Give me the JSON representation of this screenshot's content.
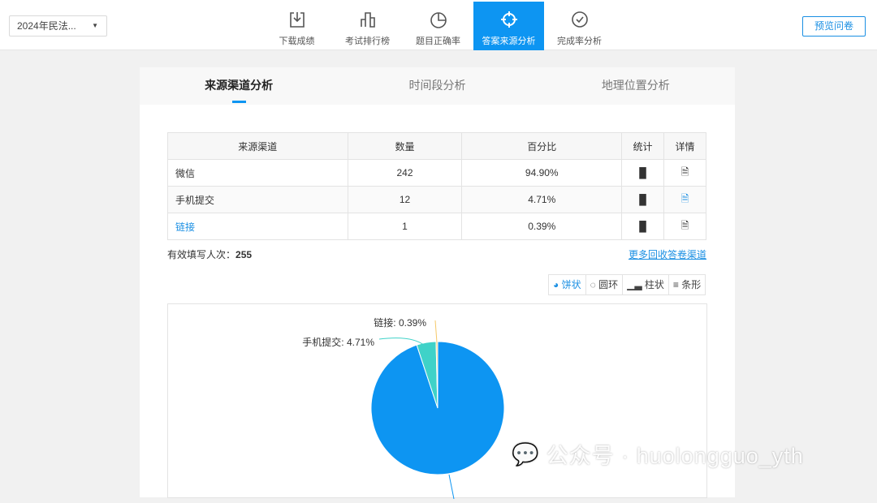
{
  "header": {
    "survey_select": "2024年民法...",
    "preview_button": "预览问卷",
    "nav": [
      {
        "label": "下载成绩",
        "icon": "download-icon"
      },
      {
        "label": "考试排行榜",
        "icon": "ranking-icon"
      },
      {
        "label": "题目正确率",
        "icon": "pie-icon"
      },
      {
        "label": "答案来源分析",
        "icon": "target-icon",
        "active": true
      },
      {
        "label": "完成率分析",
        "icon": "check-circle-icon"
      }
    ]
  },
  "tabs": [
    "来源渠道分析",
    "时间段分析",
    "地理位置分析"
  ],
  "table": {
    "headers": [
      "来源渠道",
      "数量",
      "百分比",
      "统计",
      "详情"
    ],
    "rows": [
      {
        "channel": "微信",
        "count": "242",
        "pct": "94.90%"
      },
      {
        "channel": "手机提交",
        "count": "12",
        "pct": "4.71%"
      },
      {
        "channel": "链接",
        "count": "1",
        "pct": "0.39%"
      }
    ]
  },
  "total_label": "有效填写人次：",
  "total_value": "255",
  "more_link": "更多回收答卷渠道",
  "chart_types": [
    "饼状",
    "圆环",
    "柱状",
    "条形"
  ],
  "chart_data": {
    "type": "pie",
    "slices": [
      {
        "name": "微信",
        "value": 94.9,
        "color": "#0d95f2"
      },
      {
        "name": "手机提交",
        "value": 4.71,
        "color": "#3fd2c8"
      },
      {
        "name": "链接",
        "value": 0.39,
        "color": "#f5c867"
      }
    ],
    "labels": [
      "手机提交: 4.71%",
      "链接: 0.39%"
    ]
  },
  "watermark": "公众号 · huolongguo_yth"
}
